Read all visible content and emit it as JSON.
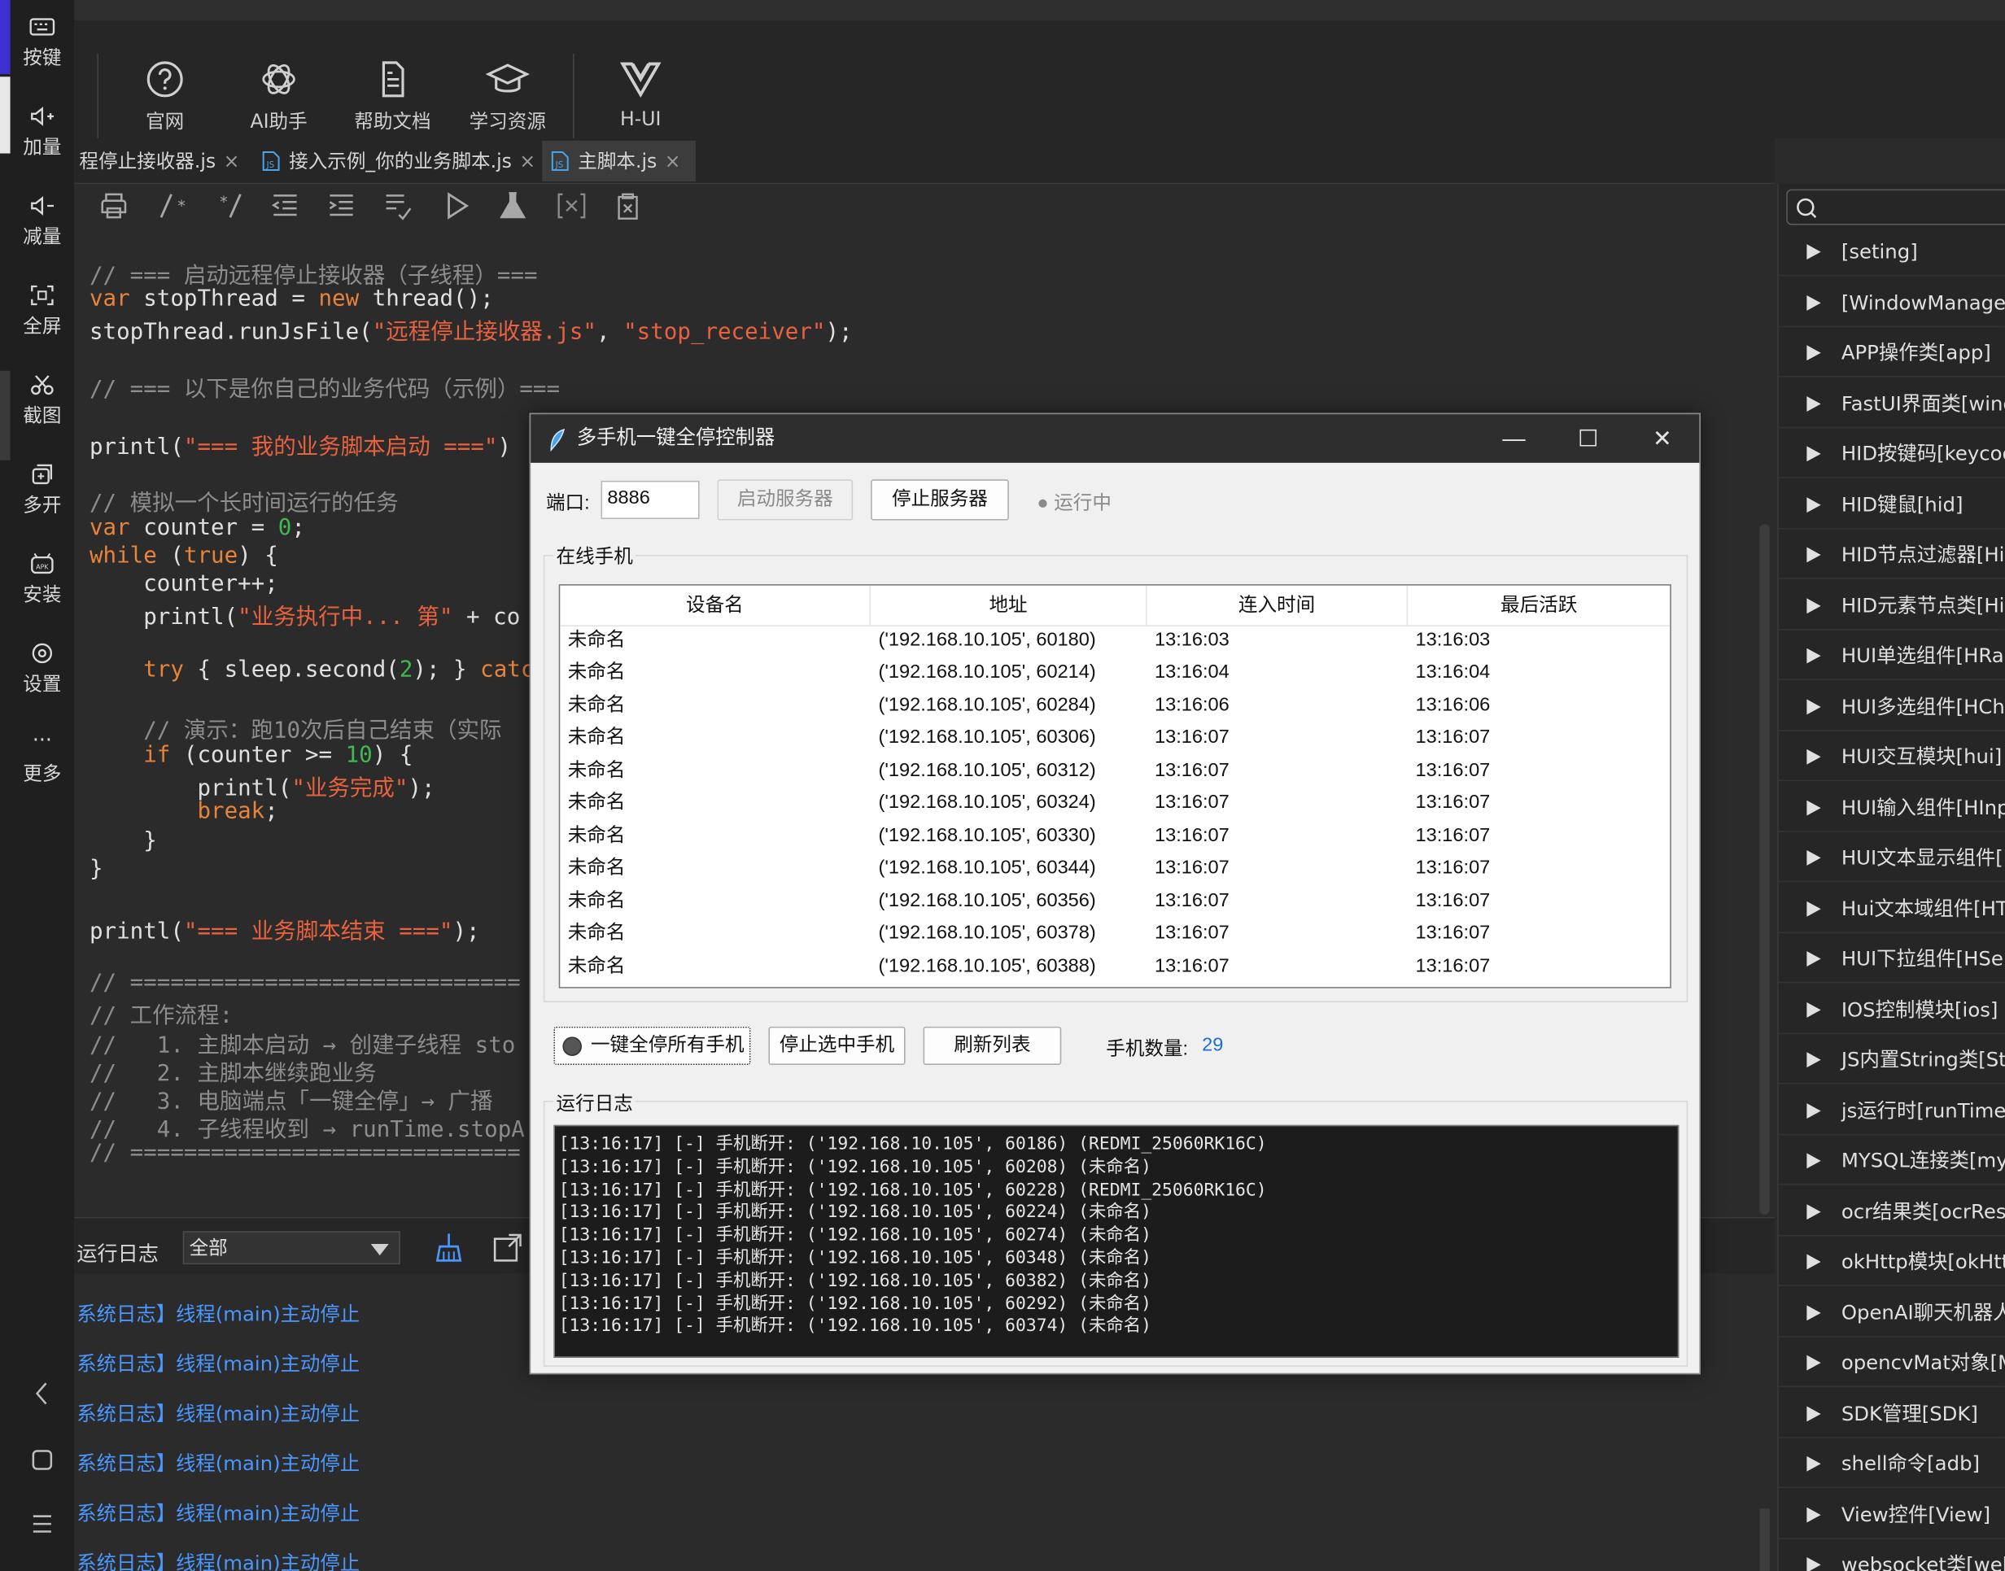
{
  "rail": {
    "items": [
      {
        "label": "按键",
        "icon": "keyboard-icon"
      },
      {
        "label": "加量",
        "icon": "volume-up-icon"
      },
      {
        "label": "减量",
        "icon": "volume-down-icon"
      },
      {
        "label": "全屏",
        "icon": "fullscreen-icon"
      },
      {
        "label": "截图",
        "icon": "scissors-icon"
      },
      {
        "label": "多开",
        "icon": "multi-open-icon"
      },
      {
        "label": "安装",
        "icon": "apk-icon"
      },
      {
        "label": "设置",
        "icon": "gear-icon"
      },
      {
        "label": "更多",
        "icon": "more-icon"
      }
    ],
    "more_dots": "···"
  },
  "toolbar": {
    "items": [
      {
        "label": "官网",
        "icon": "help-circle-icon"
      },
      {
        "label": "AI助手",
        "icon": "openai-icon"
      },
      {
        "label": "帮助文档",
        "icon": "document-icon"
      },
      {
        "label": "学习资源",
        "icon": "graduation-cap-icon"
      },
      {
        "label": "H-UI",
        "icon": "vue-logo-icon"
      }
    ]
  },
  "tabs": [
    {
      "label": "程停止接收器.js",
      "close": "×"
    },
    {
      "label": "接入示例_你的业务脚本.js",
      "close": "×"
    },
    {
      "label": "主脚本.js",
      "close": "×"
    }
  ],
  "code": {
    "lines": [
      "// === 启动远程停止接收器（子线程）===",
      "var stopThread = new thread();",
      "stopThread.runJsFile(\"远程停止接收器.js\", \"stop_receiver\");",
      "",
      "// === 以下是你自己的业务代码（示例）===",
      "",
      "printl(\"=== 我的业务脚本启动 ===\")",
      "",
      "// 模拟一个长时间运行的任务",
      "var counter = 0;",
      "while (true) {",
      "    counter++;",
      "    printl(\"业务执行中... 第\" + co",
      "",
      "    try { sleep.second(2); } catc",
      "",
      "    // 演示：跑10次后自己结束（实际",
      "    if (counter >= 10) {",
      "        printl(\"业务完成\");",
      "        break;",
      "    }",
      "}",
      "",
      "printl(\"=== 业务脚本结束 ===\");",
      "",
      "// =============================",
      "// 工作流程:",
      "//   1. 主脚本启动 → 创建子线程 sto",
      "//   2. 主脚本继续跑业务",
      "//   3. 电脑端点「一键全停」→ 广播",
      "//   4. 子线程收到 → runTime.stopA",
      "// ============================="
    ]
  },
  "log_panel": {
    "label": "运行日志",
    "filter": "全部",
    "lines": [
      "系统日志】线程(main)主动停止",
      "系统日志】线程(main)主动停止",
      "系统日志】线程(main)主动停止",
      "系统日志】线程(main)主动停止",
      "系统日志】线程(main)主动停止",
      "系统日志】线程(main)主动停止"
    ]
  },
  "right_panel": {
    "items": [
      "[seting]",
      "[WindowManager",
      "APP操作类[app]",
      "FastUI界面类[wind",
      "HID按键码[keycod",
      "HID键鼠[hid]",
      "HID节点过滤器[Hic",
      "HID元素节点类[Hic",
      "HUI单选组件[HRac",
      "HUI多选组件[HChe",
      "HUI交互模块[hui]",
      "HUI输入组件[HInp",
      "HUI文本显示组件[H",
      "Hui文本域组件[HTe",
      "HUI下拉组件[HSele",
      "IOS控制模块[ios]",
      "JS内置String类[Str",
      "js运行时[runTime]",
      "MYSQL连接类[mys",
      "ocr结果类[ocrResu",
      "okHttp模块[okHttp",
      "OpenAI聊天机器人",
      "opencvMat对象[M",
      "SDK管理[SDK]",
      "shell命令[adb]",
      "View控件[View]",
      "websocket类[web"
    ]
  },
  "dialog": {
    "title": "多手机一键全停控制器",
    "port_label": "端口:",
    "port_value": "8886",
    "start_button": "启动服务器",
    "stop_button": "停止服务器",
    "status": "● 运行中",
    "online_group": "在线手机",
    "columns": [
      "设备名",
      "地址",
      "连入时间",
      "最后活跃"
    ],
    "rows": [
      [
        "未命名",
        "('192.168.10.105', 60180)",
        "13:16:03",
        "13:16:03"
      ],
      [
        "未命名",
        "('192.168.10.105', 60214)",
        "13:16:04",
        "13:16:04"
      ],
      [
        "未命名",
        "('192.168.10.105', 60284)",
        "13:16:06",
        "13:16:06"
      ],
      [
        "未命名",
        "('192.168.10.105', 60306)",
        "13:16:07",
        "13:16:07"
      ],
      [
        "未命名",
        "('192.168.10.105', 60312)",
        "13:16:07",
        "13:16:07"
      ],
      [
        "未命名",
        "('192.168.10.105', 60324)",
        "13:16:07",
        "13:16:07"
      ],
      [
        "未命名",
        "('192.168.10.105', 60330)",
        "13:16:07",
        "13:16:07"
      ],
      [
        "未命名",
        "('192.168.10.105', 60344)",
        "13:16:07",
        "13:16:07"
      ],
      [
        "未命名",
        "('192.168.10.105', 60356)",
        "13:16:07",
        "13:16:07"
      ],
      [
        "未命名",
        "('192.168.10.105', 60378)",
        "13:16:07",
        "13:16:07"
      ],
      [
        "未命名",
        "('192.168.10.105', 60388)",
        "13:16:07",
        "13:16:07"
      ]
    ],
    "stop_all_button": "一键全停所有手机",
    "stop_selected_button": "停止选中手机",
    "refresh_button": "刷新列表",
    "count_label": "手机数量:",
    "count_value": "29",
    "log_group": "运行日志",
    "log_lines": [
      "[13:16:17] [-] 手机断开: ('192.168.10.105', 60186) (REDMI_25060RK16C)",
      "[13:16:17] [-] 手机断开: ('192.168.10.105', 60208) (未命名)",
      "[13:16:17] [-] 手机断开: ('192.168.10.105', 60228) (REDMI_25060RK16C)",
      "[13:16:17] [-] 手机断开: ('192.168.10.105', 60224) (未命名)",
      "[13:16:17] [-] 手机断开: ('192.168.10.105', 60274) (未命名)",
      "[13:16:17] [-] 手机断开: ('192.168.10.105', 60348) (未命名)",
      "[13:16:17] [-] 手机断开: ('192.168.10.105', 60382) (未命名)",
      "[13:16:17] [-] 手机断开: ('192.168.10.105', 60292) (未命名)",
      "[13:16:17] [-] 手机断开: ('192.168.10.105', 60374) (未命名)"
    ],
    "window_controls": {
      "minimize": "—",
      "maximize": "☐",
      "close": "✕"
    }
  }
}
